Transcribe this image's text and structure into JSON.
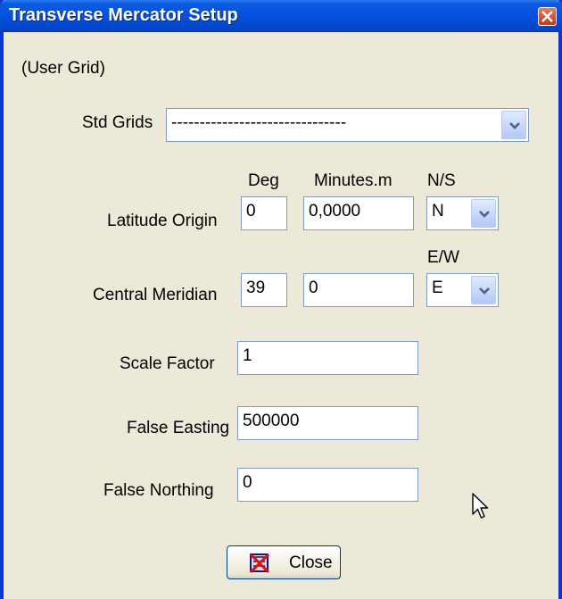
{
  "window": {
    "title": "Transverse Mercator Setup"
  },
  "grid_name": "(User Grid)",
  "std_grids": {
    "label": "Std Grids",
    "value": "-------------------------------"
  },
  "headers": {
    "deg": "Deg",
    "minutes": "Minutes.m",
    "ns": "N/S",
    "ew": "E/W"
  },
  "latitude_origin": {
    "label": "Latitude Origin",
    "deg": "0",
    "minutes": "0,0000",
    "hemisphere": "N"
  },
  "central_meridian": {
    "label": "Central Meridian",
    "deg": "39",
    "minutes": "0",
    "hemisphere": "E"
  },
  "scale_factor": {
    "label": "Scale Factor",
    "value": "1"
  },
  "false_easting": {
    "label": "False Easting",
    "value": "500000"
  },
  "false_northing": {
    "label": "False Northing",
    "value": "0"
  },
  "close_button": {
    "label": "Close"
  },
  "colors": {
    "titlebar": "#0552de",
    "window_face": "#ece9d8",
    "field_border": "#7f9db9"
  }
}
